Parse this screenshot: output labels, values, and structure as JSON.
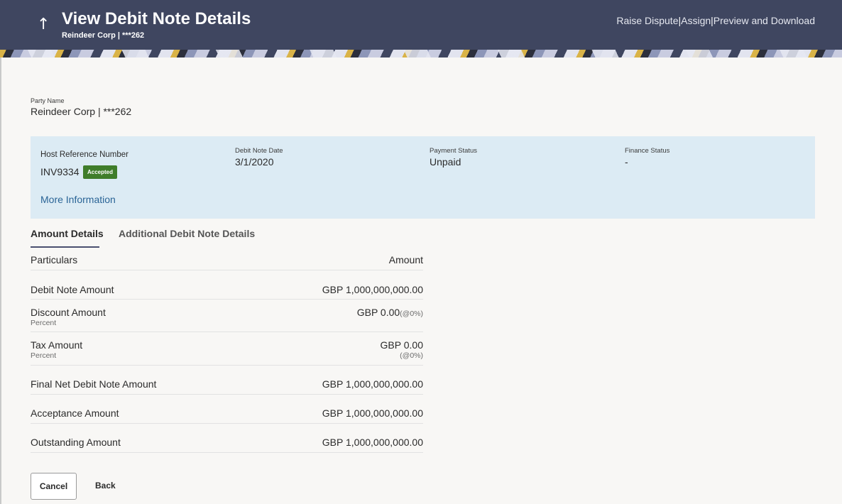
{
  "header": {
    "title": "View Debit Note Details",
    "subtitle": "Reindeer Corp | ***262",
    "actions": [
      "Raise Dispute",
      "Assign",
      "Preview and Download"
    ],
    "separator": "|"
  },
  "party": {
    "label": "Party Name",
    "value": "Reindeer Corp | ***262"
  },
  "info": {
    "host_reference_label": "Host Reference Number",
    "host_reference_value": "INV9334",
    "status_badge": "Accepted",
    "debit_note_date_label": "Debit Note Date",
    "debit_note_date_value": "3/1/2020",
    "payment_status_label": "Payment Status",
    "payment_status_value": "Unpaid",
    "finance_status_label": "Finance Status",
    "finance_status_value": "-",
    "more_information": "More Information"
  },
  "tabs": [
    {
      "label": "Amount Details",
      "active": true
    },
    {
      "label": "Additional Debit Note Details",
      "active": false
    }
  ],
  "table": {
    "header": {
      "particulars": "Particulars",
      "amount": "Amount"
    },
    "rows": [
      {
        "label": "Debit Note Amount",
        "value": "GBP 1,000,000,000.00"
      },
      {
        "label": "Discount Amount",
        "sub": "Percent",
        "value": "GBP 0.00",
        "pct": "(@0%)"
      },
      {
        "label": "Tax Amount",
        "sub": "Percent",
        "value": "GBP 0.00",
        "pct": "(@0%)"
      },
      {
        "label": "Final Net Debit Note Amount",
        "value": "GBP 1,000,000,000.00"
      },
      {
        "label": "Acceptance Amount",
        "value": "GBP 1,000,000,000.00"
      },
      {
        "label": "Outstanding Amount",
        "value": "GBP 1,000,000,000.00"
      }
    ]
  },
  "buttons": {
    "cancel": "Cancel",
    "back": "Back"
  },
  "colors": {
    "header_bg": "#3f4660",
    "panel_bg": "#dcebf4",
    "badge_green": "#3f7d2a",
    "link_blue": "#2a6496"
  }
}
